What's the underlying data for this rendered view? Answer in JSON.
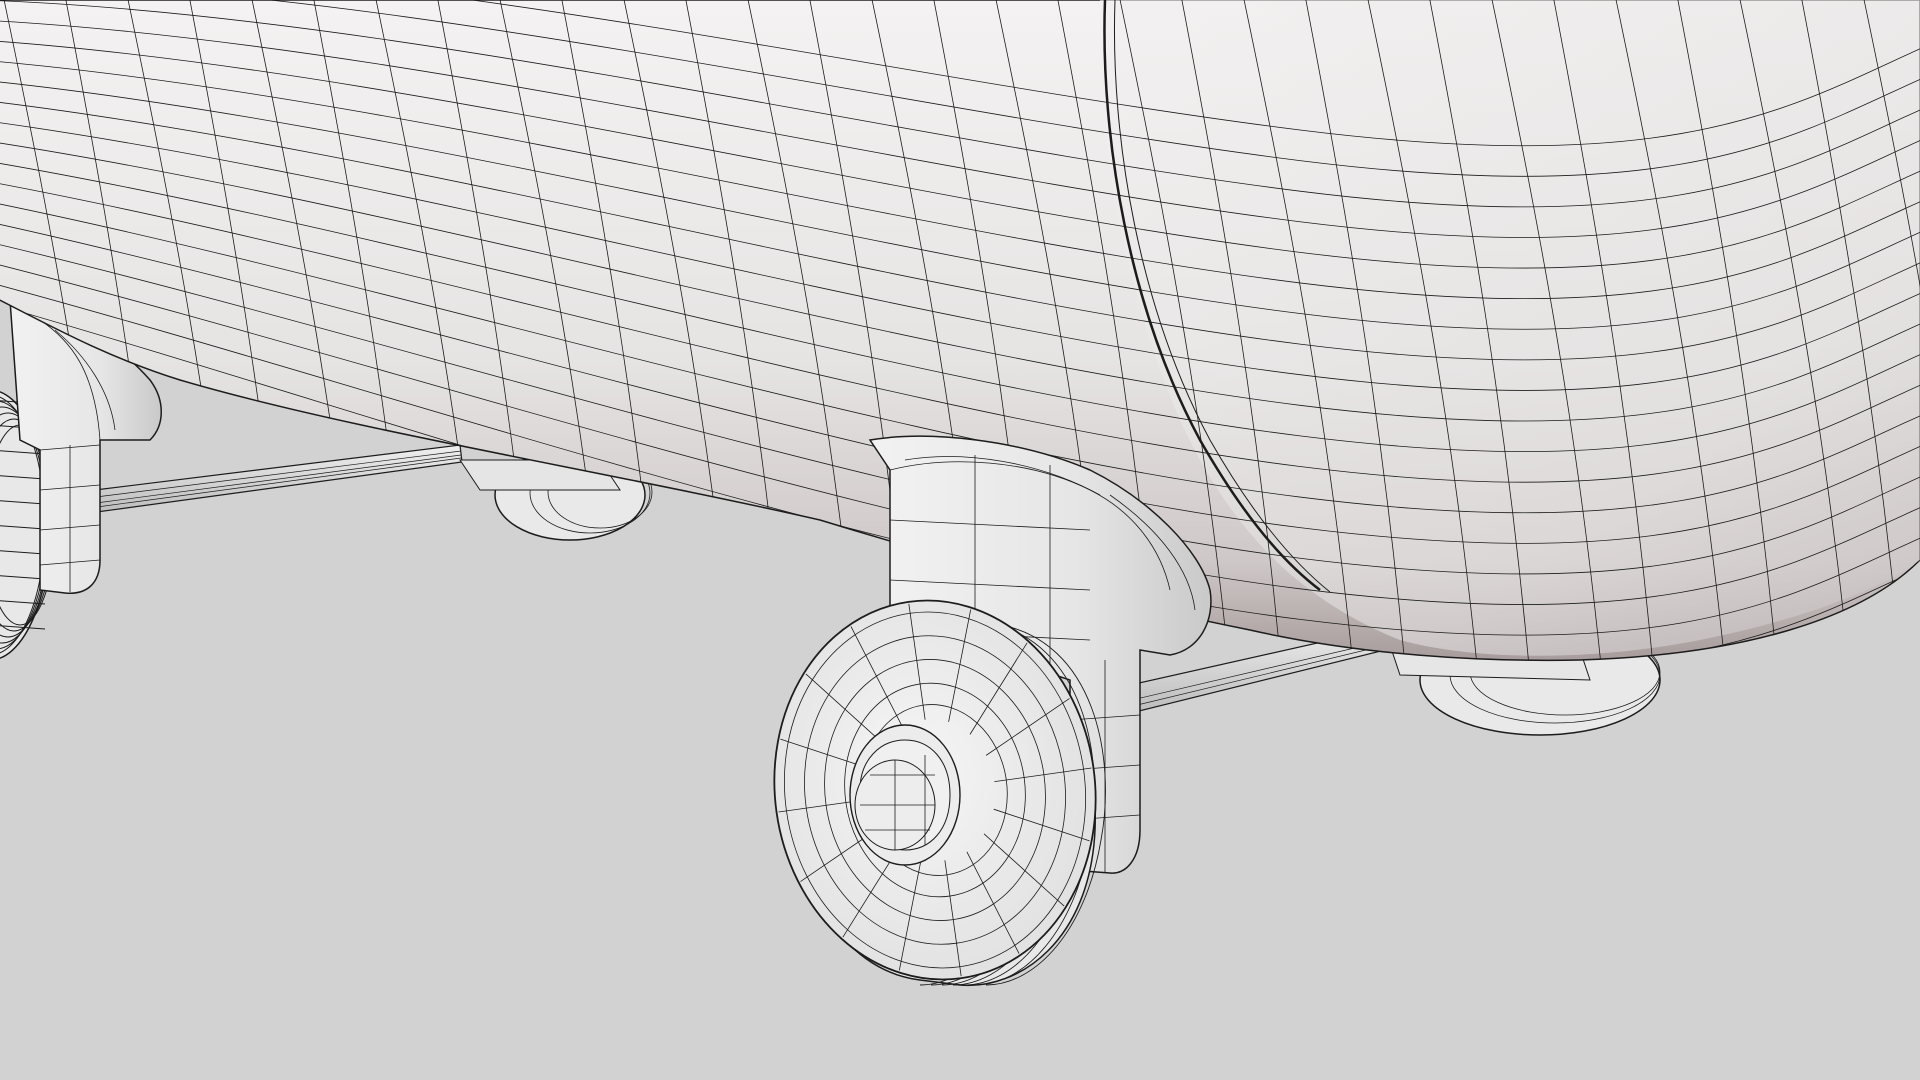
{
  "scene": {
    "subject": "wireframe-tank-wheel-assembly",
    "colors": {
      "background": "#d2d2d2",
      "surface_light": "#f0eeee",
      "surface_mid": "#dcd9d9",
      "surface_shadow": "#b9b2b2",
      "underside_tint": "#8f7f7f",
      "wire": "#1c1c1c"
    }
  }
}
